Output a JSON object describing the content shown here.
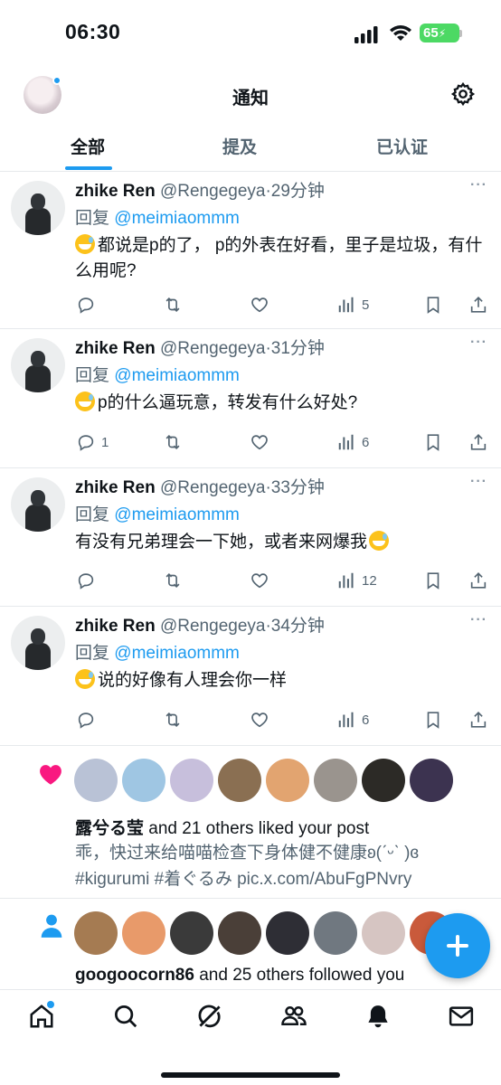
{
  "status_bar": {
    "time": "06:30",
    "battery": "65"
  },
  "header": {
    "title": "通知"
  },
  "tabs": [
    {
      "label": "全部",
      "active": true
    },
    {
      "label": "提及",
      "active": false
    },
    {
      "label": "已认证",
      "active": false
    }
  ],
  "tweets": [
    {
      "name": "zhike Ren",
      "handle": "@Rengegeya",
      "time": "·29分钟",
      "reply_prefix": "回复",
      "mention": "@meimiaommm",
      "text": "都说是p的了， p的外表在好看，里子是垃圾，有什么用呢?",
      "emoji_position": "start",
      "replies": "",
      "views": "5"
    },
    {
      "name": "zhike Ren",
      "handle": "@Rengegeya",
      "time": "·31分钟",
      "reply_prefix": "回复",
      "mention": "@meimiaommm",
      "text": "p的什么逼玩意，转发有什么好处?",
      "emoji_position": "start",
      "replies": "1",
      "views": "6"
    },
    {
      "name": "zhike Ren",
      "handle": "@Rengegeya",
      "time": "·33分钟",
      "reply_prefix": "回复",
      "mention": "@meimiaommm",
      "text": "有没有兄弟理会一下她，或者来网爆我",
      "emoji_position": "end",
      "replies": "",
      "views": "12"
    },
    {
      "name": "zhike Ren",
      "handle": "@Rengegeya",
      "time": "·34分钟",
      "reply_prefix": "回复",
      "mention": "@meimiaommm",
      "text": "说的好像有人理会你一样",
      "emoji_position": "start",
      "replies": "",
      "views": "6"
    }
  ],
  "like_notification": {
    "icon": "heart-icon",
    "actor": "露兮る莹",
    "rest": " and 21 others liked your post",
    "post_line1": "乖，快过来给喵喵检查下身体健不健康ʚ(ˊᵕˋ )ɞ",
    "post_line2": "#kigurumi #着ぐるみ pic.x.com/AbuFgPNvry",
    "avatar_colors": [
      "#b9c2d6",
      "#9fc6e3",
      "#c7bfdc",
      "#8a6f52",
      "#e2a470",
      "#9a948e",
      "#2c2a26",
      "#3c3350"
    ]
  },
  "follow_notification": {
    "icon": "person-icon",
    "actor": "googoocorn86",
    "rest": " and 25 others followed you",
    "avatar_colors": [
      "#a57b52",
      "#e89a6a",
      "#3a3a3a",
      "#4a3f38",
      "#2e2e35",
      "#707880",
      "#d6c5c2",
      "#c95a3b"
    ]
  },
  "bottom_nav": [
    "home-icon",
    "search-icon",
    "grok-icon",
    "communities-icon",
    "notifications-icon",
    "messages-icon"
  ],
  "colors": {
    "accent": "#1d9bf0",
    "like": "#f91880",
    "text_secondary": "#536471"
  }
}
